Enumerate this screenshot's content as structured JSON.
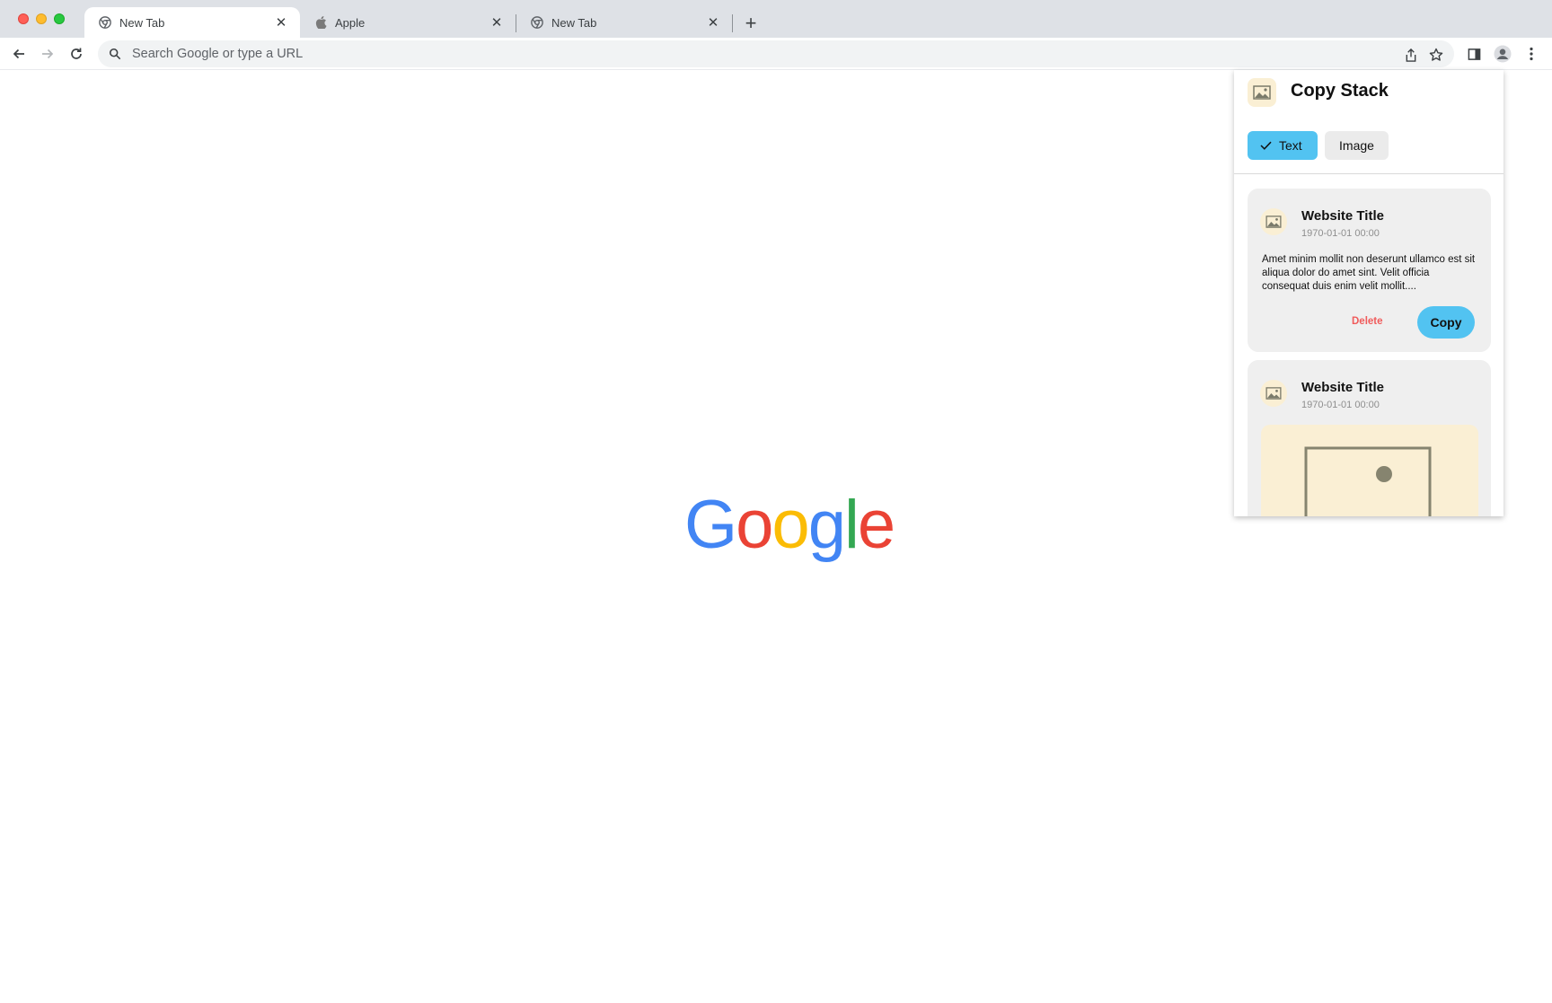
{
  "window": {
    "tabs": [
      {
        "title": "New Tab",
        "favicon": "chrome-icon",
        "active": true
      },
      {
        "title": "Apple",
        "favicon": "apple-icon",
        "active": false
      },
      {
        "title": "New Tab",
        "favicon": "chrome-icon",
        "active": false
      }
    ]
  },
  "toolbar": {
    "omnibox_placeholder": "Search Google or type a URL"
  },
  "page": {
    "logo_letters": [
      "G",
      "o",
      "o",
      "g",
      "l",
      "e"
    ],
    "logo_colors": [
      "#4285F4",
      "#EA4335",
      "#FBBC05",
      "#4285F4",
      "#34A853",
      "#EA4335"
    ]
  },
  "extension": {
    "title": "Copy Stack",
    "filters": [
      {
        "label": "Text",
        "selected": true
      },
      {
        "label": "Image",
        "selected": false
      }
    ],
    "accent_color": "#52C3F1",
    "cards": [
      {
        "title": "Website Title",
        "date": "1970-01-01 00:00",
        "body": "Amet minim mollit non deserunt ullamco est sit aliqua dolor do amet sint. Velit officia consequat duis enim velit mollit....",
        "delete_label": "Delete",
        "copy_label": "Copy"
      },
      {
        "title": "Website Title",
        "date": "1970-01-01 00:00",
        "thumbnail": "image-placeholder-icon"
      }
    ]
  }
}
